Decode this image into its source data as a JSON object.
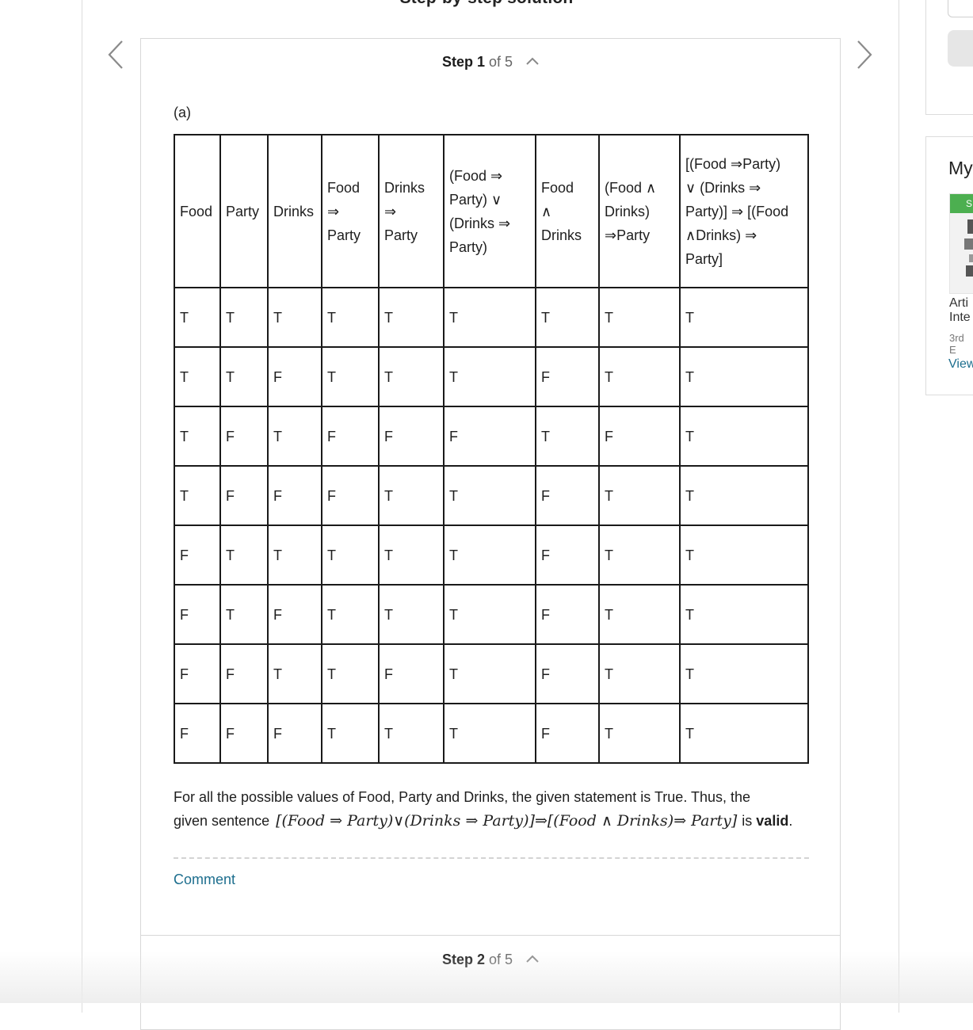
{
  "page": {
    "heading": "Step-by-step solution"
  },
  "step1": {
    "label": "Step",
    "number": "1",
    "of_text": "of 5"
  },
  "step2": {
    "label": "Step",
    "number": "2",
    "of_text": "of 5"
  },
  "part_label": "(a)",
  "table": {
    "headers": [
      "Food",
      "Party",
      "Drinks",
      "Food\n⇒\nParty",
      "Drinks\n⇒\nParty",
      "(Food ⇒\nParty) ∨\n(Drinks ⇒\nParty)",
      "Food\n∧\nDrinks",
      "(Food ∧\nDrinks)\n⇒Party",
      "[(Food ⇒Party)\n∨ (Drinks ⇒\nParty)] ⇒ [(Food\n∧Drinks) ⇒\nParty]"
    ],
    "rows": [
      [
        "T",
        "T",
        "T",
        "T",
        "T",
        "T",
        "T",
        "T",
        "T"
      ],
      [
        "T",
        "T",
        "F",
        "T",
        "T",
        "T",
        "F",
        "T",
        "T"
      ],
      [
        "T",
        "F",
        "T",
        "F",
        "F",
        "F",
        "T",
        "F",
        "T"
      ],
      [
        "T",
        "F",
        "F",
        "F",
        "T",
        "T",
        "F",
        "T",
        "T"
      ],
      [
        "F",
        "T",
        "T",
        "T",
        "T",
        "T",
        "F",
        "T",
        "T"
      ],
      [
        "F",
        "T",
        "F",
        "T",
        "T",
        "T",
        "F",
        "T",
        "T"
      ],
      [
        "F",
        "F",
        "T",
        "T",
        "F",
        "T",
        "F",
        "T",
        "T"
      ],
      [
        "F",
        "F",
        "F",
        "T",
        "T",
        "T",
        "F",
        "T",
        "T"
      ]
    ]
  },
  "conclusion": {
    "line1": "For all the possible values of Food, Party and Drinks, the given statement is True. Thus, the",
    "pre": "given sentence",
    "formula": "[(Food ⇒ Party)∨(Drinks ⇒ Party)]⇒[(Food ∧ Drinks)⇒ Party]",
    "mid": "is",
    "bold": "valid",
    "end": "."
  },
  "comment_label": "Comment",
  "sidebar": {
    "title": "My",
    "badge": "S",
    "book_title": "Arti\nInte",
    "edition": "3rd E",
    "view_label": "View"
  },
  "icons": {
    "prev": "chevron-left-icon",
    "next": "chevron-right-icon",
    "collapse": "chevron-up-icon"
  },
  "colors": {
    "link": "#1d6e8e",
    "badge": "#4caf50"
  }
}
